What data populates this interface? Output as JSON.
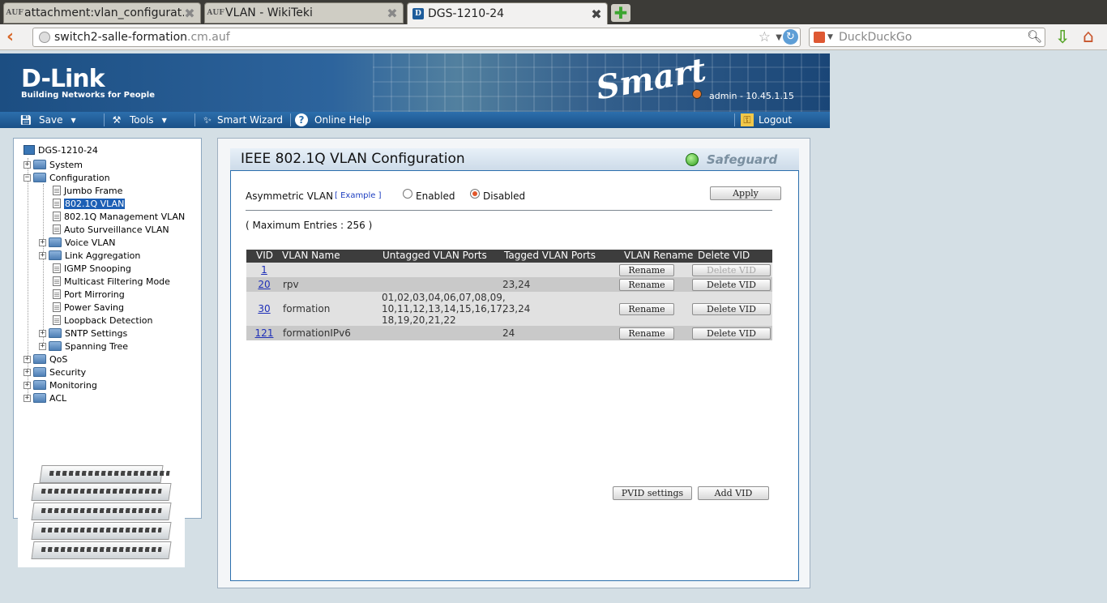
{
  "browser": {
    "tabs": [
      {
        "favicon": "AUF",
        "title": "attachment:vlan_configurat…"
      },
      {
        "favicon": "AUF",
        "title": "VLAN - WikiTeki"
      },
      {
        "favicon": "D",
        "title": "DGS-1210-24"
      }
    ],
    "url_host": "switch2-salle-formation",
    "url_rest": ".cm.auf",
    "search_placeholder": "DuckDuckGo"
  },
  "header": {
    "brand": "D-Link",
    "tagline": "Building Networks for People",
    "product_line": "Smart",
    "user_info": "admin - 10.45.1.15"
  },
  "menubar": {
    "save": "Save",
    "tools": "Tools",
    "smart_wizard": "Smart Wizard",
    "online_help": "Online Help",
    "logout": "Logout"
  },
  "tree": {
    "root": "DGS-1210-24",
    "system": "System",
    "configuration": "Configuration",
    "config_children": [
      "Jumbo Frame",
      "802.1Q VLAN",
      "802.1Q Management VLAN",
      "Auto Surveillance VLAN",
      "Voice VLAN",
      "Link Aggregation",
      "IGMP Snooping",
      "Multicast Filtering Mode",
      "Port Mirroring",
      "Power Saving",
      "Loopback Detection",
      "SNTP Settings",
      "Spanning Tree"
    ],
    "qos": "QoS",
    "security": "Security",
    "monitoring": "Monitoring",
    "acl": "ACL",
    "selected": "802.1Q VLAN"
  },
  "page": {
    "title": "IEEE 802.1Q VLAN Configuration",
    "safeguard": "Safeguard",
    "asym_label": "Asymmetric VLAN",
    "example_link": "[ Example ]",
    "enabled": "Enabled",
    "disabled": "Disabled",
    "asym_value": "Disabled",
    "apply": "Apply",
    "max_entries": "( Maximum Entries : 256 )",
    "table_headers": [
      "VID",
      "VLAN Name",
      "Untagged VLAN Ports",
      "Tagged VLAN Ports",
      "VLAN Rename",
      "Delete VID"
    ],
    "rows": [
      {
        "vid": "1",
        "name": "",
        "untagged": "",
        "tagged": "",
        "rename": "Rename",
        "delete": "Delete VID",
        "delete_disabled": true
      },
      {
        "vid": "20",
        "name": "rpv",
        "untagged": "",
        "tagged": "23,24",
        "rename": "Rename",
        "delete": "Delete VID",
        "delete_disabled": false
      },
      {
        "vid": "30",
        "name": "formation",
        "untagged": "01,02,03,04,06,07,08,09,\n10,11,12,13,14,15,16,17,\n18,19,20,21,22",
        "tagged": "23,24",
        "rename": "Rename",
        "delete": "Delete VID",
        "delete_disabled": false
      },
      {
        "vid": "121",
        "name": "formationIPv6",
        "untagged": "",
        "tagged": "24",
        "rename": "Rename",
        "delete": "Delete VID",
        "delete_disabled": false
      }
    ],
    "pvid_settings": "PVID settings",
    "add_vid": "Add VID"
  }
}
